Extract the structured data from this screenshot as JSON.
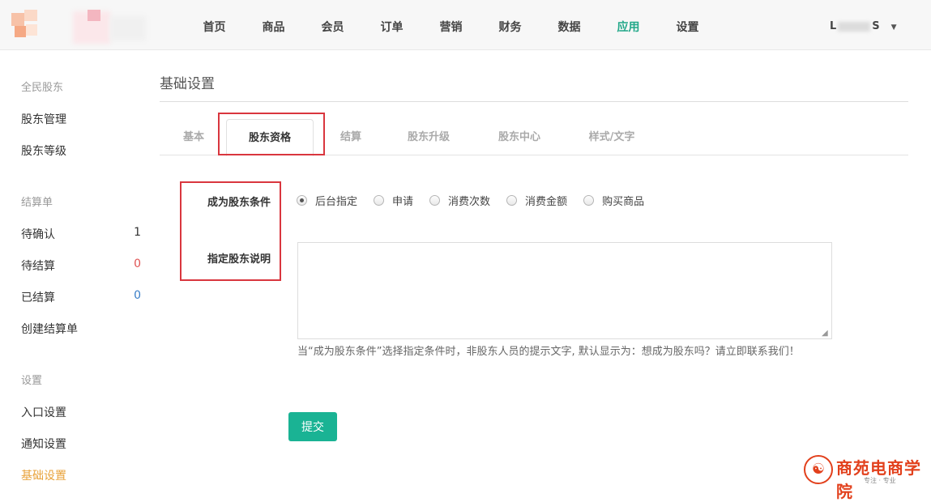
{
  "nav": {
    "items": [
      {
        "label": "首页",
        "active": false
      },
      {
        "label": "商品",
        "active": false
      },
      {
        "label": "会员",
        "active": false
      },
      {
        "label": "订单",
        "active": false
      },
      {
        "label": "营销",
        "active": false
      },
      {
        "label": "财务",
        "active": false
      },
      {
        "label": "数据",
        "active": false
      },
      {
        "label": "应用",
        "active": true
      },
      {
        "label": "设置",
        "active": false
      }
    ],
    "user_prefix": "L",
    "user_suffix": "S",
    "accent_color": "#22a889"
  },
  "sidebar": {
    "group1": "全民股东",
    "items1": [
      "股东管理",
      "股东等级"
    ],
    "group2": "结算单",
    "items2": [
      {
        "label": "待确认",
        "count": "1",
        "color": "#333333"
      },
      {
        "label": "待结算",
        "count": "0",
        "color": "#e05454"
      },
      {
        "label": "已结算",
        "count": "0",
        "color": "#3a7fc8"
      },
      {
        "label": "创建结算单",
        "count": ""
      }
    ],
    "group3": "设置",
    "items3": [
      "入口设置",
      "通知设置",
      "基础设置"
    ],
    "active_color": "#e8a23a"
  },
  "main": {
    "title": "基础设置",
    "tabs": [
      {
        "label": "基本",
        "active": false
      },
      {
        "label": "股东资格",
        "active": true
      },
      {
        "label": "结算",
        "active": false
      },
      {
        "label": "股东升级",
        "active": false
      },
      {
        "label": "股东中心",
        "active": false
      },
      {
        "label": "样式/文字",
        "active": false
      }
    ],
    "condition_label": "成为股东条件",
    "condition_options": [
      {
        "label": "后台指定",
        "checked": true
      },
      {
        "label": "申请",
        "checked": false
      },
      {
        "label": "消费次数",
        "checked": false
      },
      {
        "label": "消费金额",
        "checked": false
      },
      {
        "label": "购买商品",
        "checked": false
      }
    ],
    "explain_label": "指定股东说明",
    "explain_value": "",
    "help_text": "当“成为股东条件”选择指定条件时，非股东人员的提示文字, 默认显示为：想成为股东吗？请立即联系我们！",
    "submit_label": "提交",
    "submit_color": "#1ab394"
  },
  "brand": {
    "name": "商苑电商学院",
    "tagline": "专注 · 专业"
  }
}
